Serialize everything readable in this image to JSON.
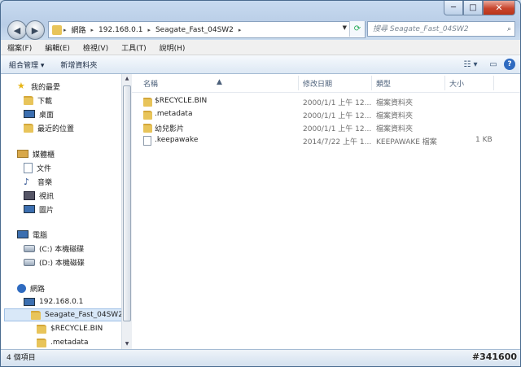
{
  "window": {
    "minimize_glyph": "─",
    "maximize_glyph": "□",
    "close_glyph": "✕"
  },
  "nav": {
    "back_glyph": "◀",
    "forward_glyph": "▶"
  },
  "address": {
    "crumbs": [
      "網路",
      "192.168.0.1",
      "Seagate_Fast_04SW2"
    ],
    "separator": "▸"
  },
  "search": {
    "placeholder": "搜尋 Seagate_Fast_04SW2",
    "icon": "search-icon"
  },
  "menu": [
    "檔案(F)",
    "編輯(E)",
    "檢視(V)",
    "工具(T)",
    "說明(H)"
  ],
  "toolbar": {
    "organize": "組合管理 ▾",
    "new_folder": "新增資料夾",
    "views_glyph": "☷ ▾",
    "preview_glyph": "▭",
    "help_glyph": "?"
  },
  "sidebar": {
    "favorites": {
      "label": "我的最愛",
      "items": [
        "下載",
        "桌面",
        "最近的位置"
      ]
    },
    "libraries": {
      "label": "媒體櫃",
      "items": [
        "文件",
        "音樂",
        "視訊",
        "圖片"
      ]
    },
    "computer": {
      "label": "電腦",
      "items": [
        "(C:) 本機磁碟",
        "(D:) 本機磁碟"
      ]
    },
    "network": {
      "label": "網路",
      "items": [
        "192.168.0.1",
        "Seagate_Fast_04SW2",
        "$RECYCLE.BIN",
        ".metadata"
      ]
    }
  },
  "columns": {
    "name": "名稱",
    "date": "修改日期",
    "type": "類型",
    "size": "大小"
  },
  "files": [
    {
      "name": "$RECYCLE.BIN",
      "date": "2000/1/1 上午 12...",
      "type": "檔案資料夾",
      "size": "",
      "kind": "folder"
    },
    {
      "name": ".metadata",
      "date": "2000/1/1 上午 12...",
      "type": "檔案資料夾",
      "size": "",
      "kind": "folder"
    },
    {
      "name": "幼兒影片",
      "date": "2000/1/1 上午 12...",
      "type": "檔案資料夾",
      "size": "",
      "kind": "folder"
    },
    {
      "name": ".keepawake",
      "date": "2014/7/22 上午 1...",
      "type": "KEEPAWAKE 檔案",
      "size": "1 KB",
      "kind": "file"
    }
  ],
  "status": {
    "count": "4 個項目"
  },
  "watermark": "#341600"
}
